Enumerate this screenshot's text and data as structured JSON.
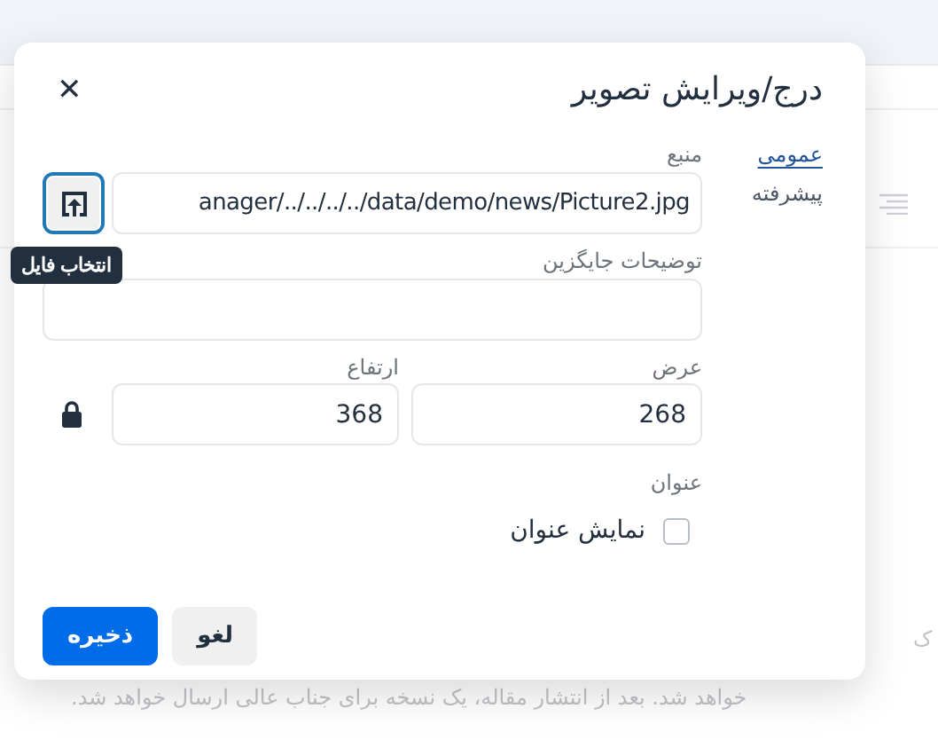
{
  "background": {
    "text_fragment_right": "ک",
    "text_line": "خواهد شد. بعد از انتشار مقاله، یک نسخه برای جناب عالی ارسال خواهد شد."
  },
  "dialog": {
    "title": "درج/ویرایش تصویر",
    "close": "✕",
    "tabs": [
      {
        "label": "عمومی",
        "selected": true
      },
      {
        "label": "پیشرفته",
        "selected": false
      }
    ],
    "source": {
      "label": "منبع",
      "value": "anager/../../../../data/demo/news/Picture2.jpg",
      "tooltip": "انتخاب فایل"
    },
    "alt": {
      "label": "توضیحات جایگزین"
    },
    "width": {
      "label": "عرض",
      "value": "268"
    },
    "height": {
      "label": "ارتفاع",
      "value": "368"
    },
    "constrain": {
      "locked": true
    },
    "caption": {
      "label": "عنوان",
      "checkbox_label": "نمایش عنوان",
      "checked": false
    },
    "buttons": [
      {
        "label": "لغو",
        "kind": "secondary"
      },
      {
        "label": "ذخیره",
        "kind": "primary"
      }
    ]
  }
}
